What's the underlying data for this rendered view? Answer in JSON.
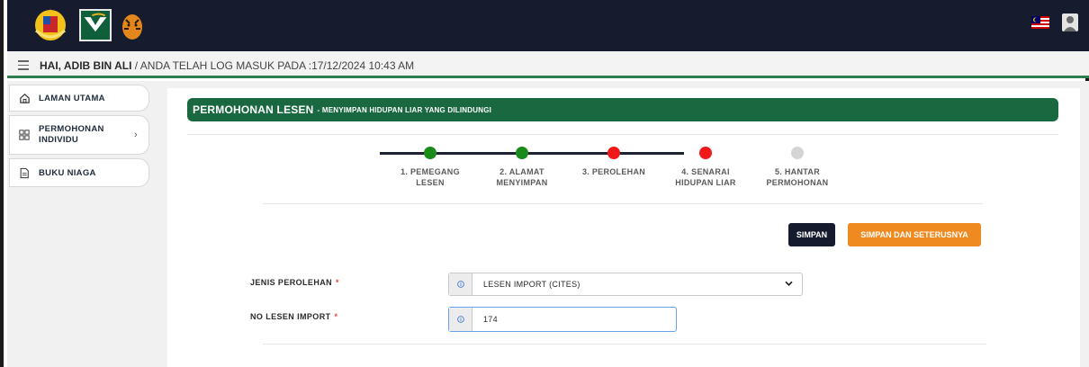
{
  "header": {
    "greeting": "HAI, ADIB BIN ALI",
    "login_info": " / ANDA TELAH LOG MASUK PADA :17/12/2024 10:43 AM"
  },
  "sidebar": {
    "items": [
      {
        "label": "LAMAN UTAMA",
        "icon": "home-icon"
      },
      {
        "label_line1": "PERMOHONAN",
        "label_line2": "INDIVIDU",
        "icon": "grid-icon",
        "chevron": "›"
      },
      {
        "label": "BUKU NIAGA",
        "icon": "document-icon"
      }
    ]
  },
  "page": {
    "title": "PERMOHONAN LESEN",
    "subtitle": "- MENYIMPAN HIDUPAN LIAR YANG DILINDUNGI"
  },
  "stepper": {
    "steps": [
      {
        "line1": "1. PEMEGANG",
        "line2": "LESEN",
        "status": "complete",
        "color": "#1a8a1a"
      },
      {
        "line1": "2. ALAMAT",
        "line2": "MENYIMPAN",
        "status": "complete",
        "color": "#1a8a1a"
      },
      {
        "line1": "3. PEROLEHAN",
        "line2": "",
        "status": "current",
        "color": "#f01818"
      },
      {
        "line1": "4. SENARAI",
        "line2": "HIDUPAN LIAR",
        "status": "current",
        "color": "#f01818"
      },
      {
        "line1": "5. HANTAR",
        "line2": "PERMOHONAN",
        "status": "pending",
        "color": "#d4d4d4"
      }
    ]
  },
  "actions": {
    "save_label": "SIMPAN",
    "save_next_label": "SIMPAN DAN SETERUSNYA"
  },
  "form": {
    "jenis_perolehan": {
      "label": "JENIS PEROLEHAN",
      "required_mark": "*",
      "value": "LESEN IMPORT (CITES)"
    },
    "no_lesen_import": {
      "label": "NO LESEN IMPORT",
      "required_mark": "*",
      "value": "174"
    }
  },
  "colors": {
    "topbar": "#161b2e",
    "brand_green": "#19683f",
    "accent_orange": "#ef8a20",
    "complete_green": "#1a8a1a",
    "current_red": "#f01818",
    "pending_grey": "#d4d4d4"
  }
}
